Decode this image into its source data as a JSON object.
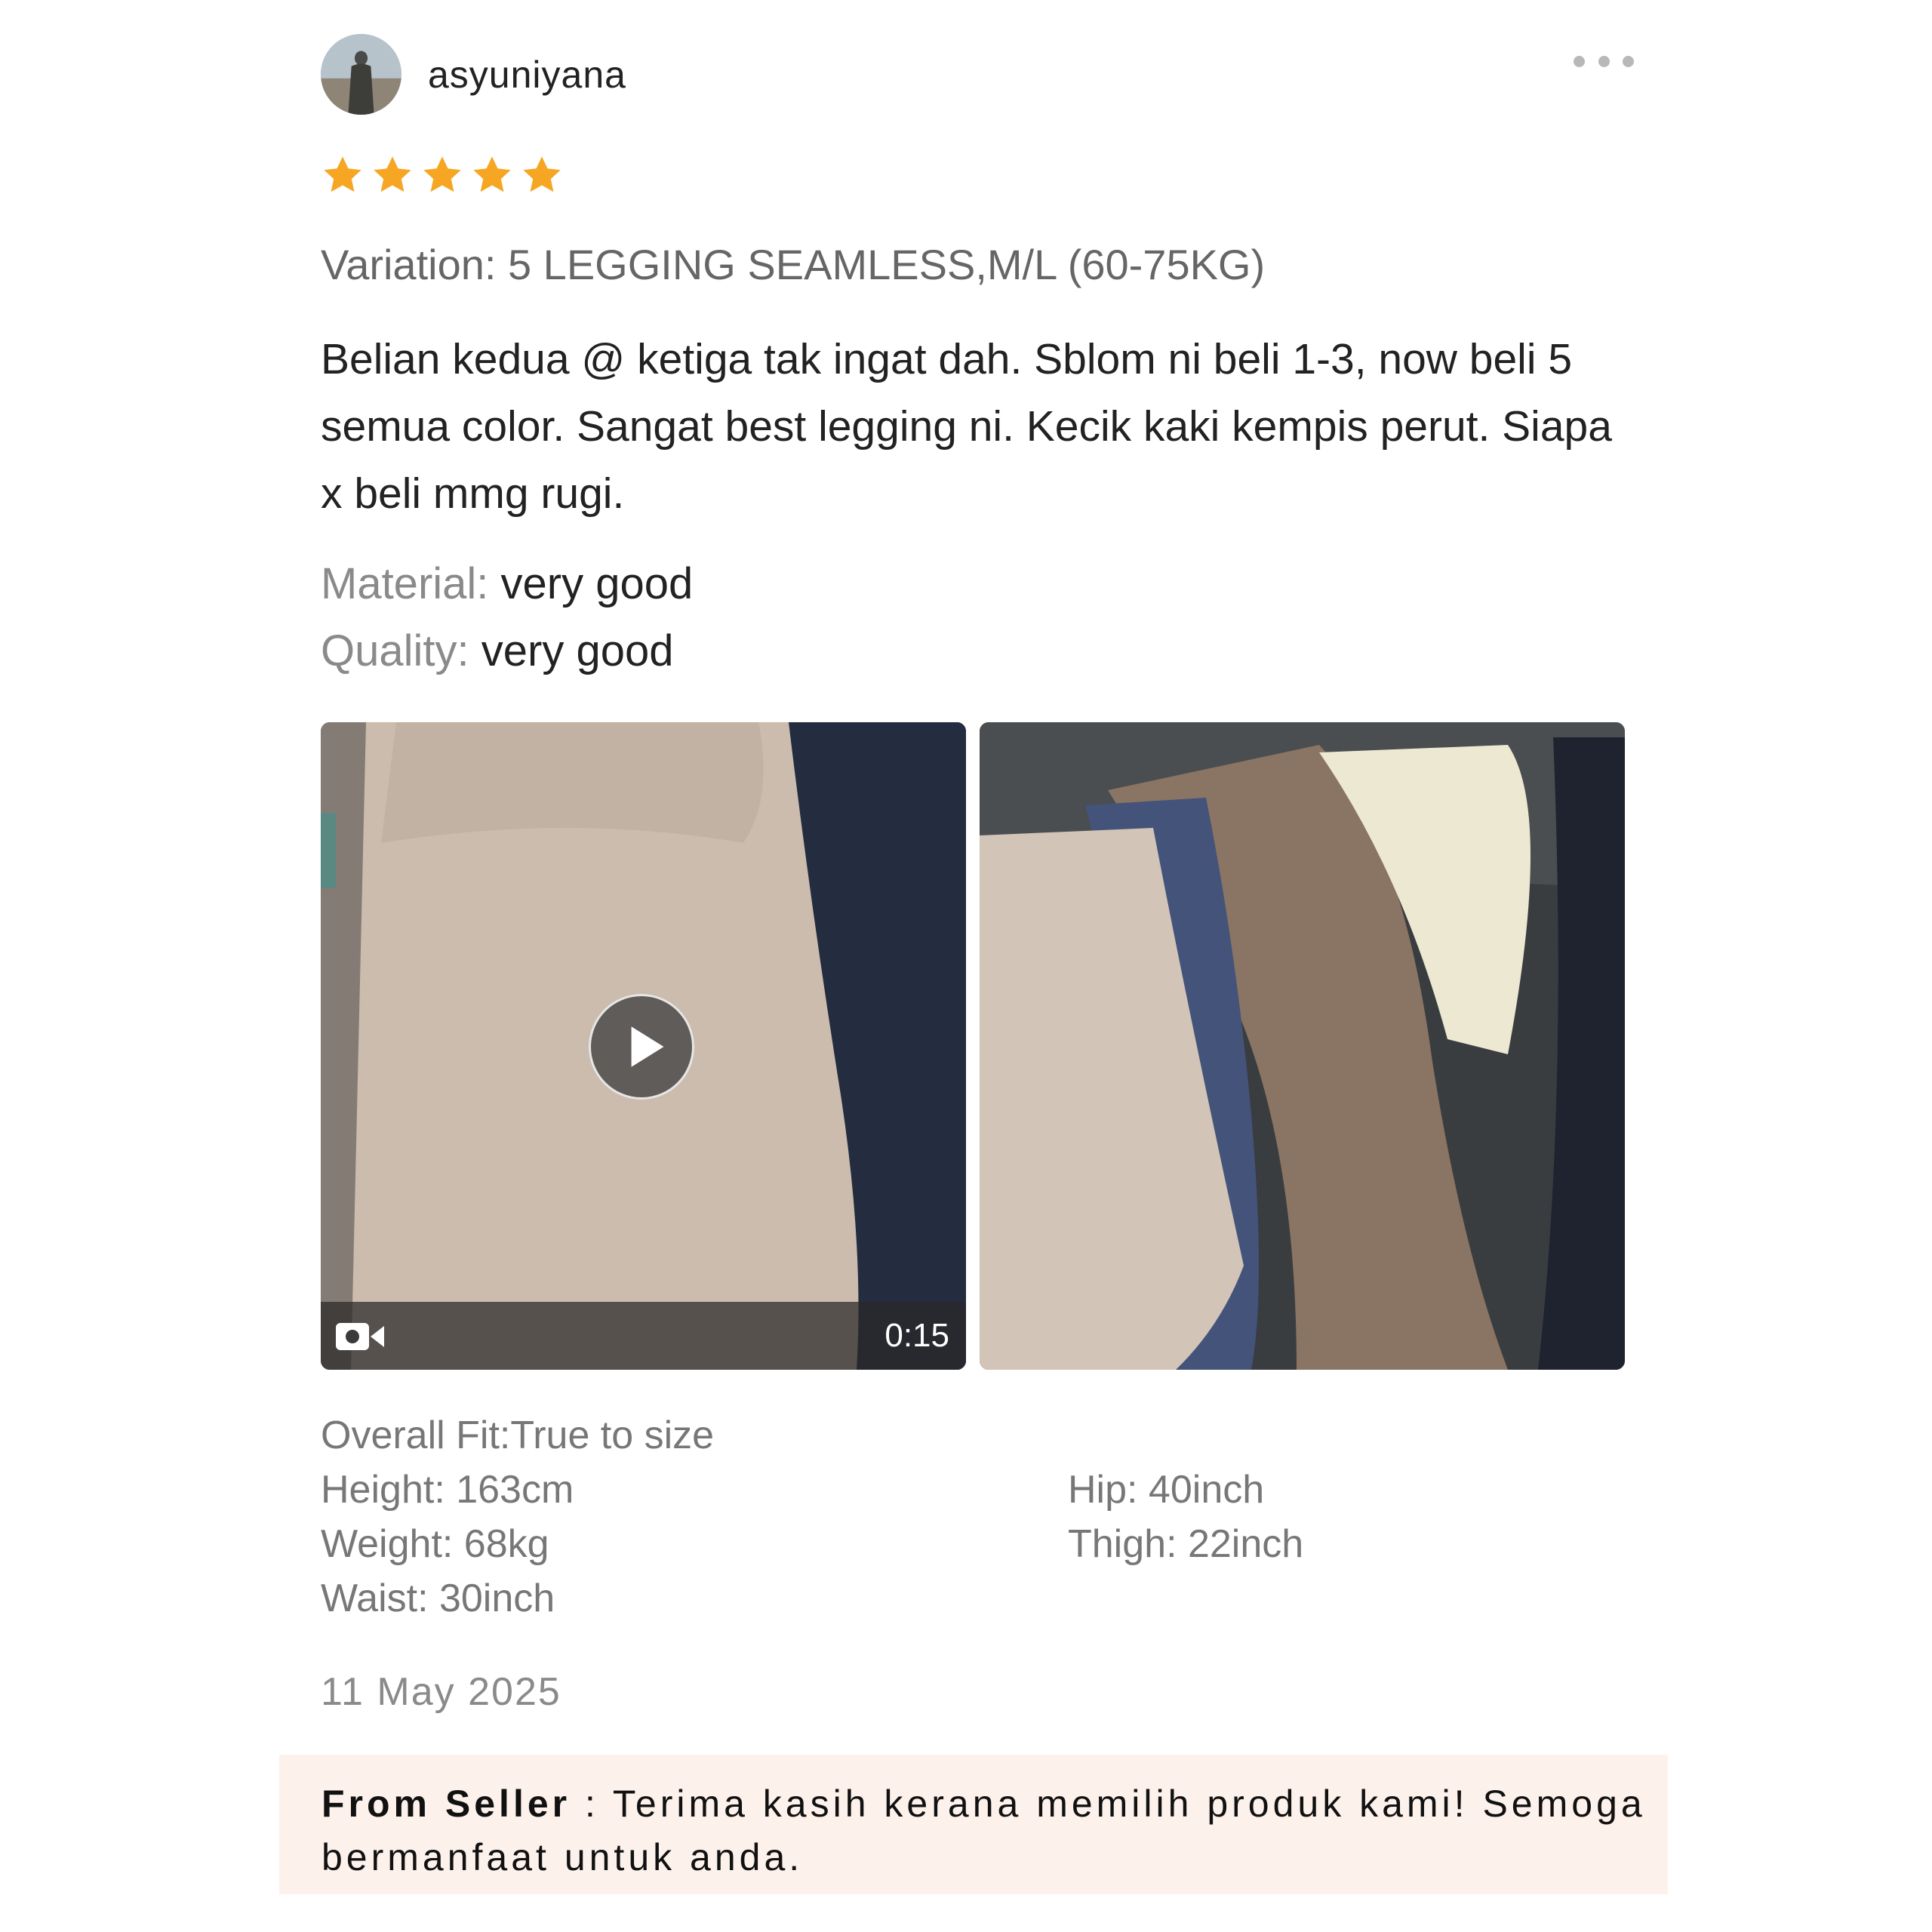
{
  "user": {
    "name": "asyuniyana",
    "rating": 5,
    "rating_max": 5
  },
  "menu": {
    "icon": "more-horizontal-icon"
  },
  "review": {
    "variation": "Variation: 5 LEGGING SEAMLESS,M/L (60-75KG)",
    "comment": "Belian kedua @ ketiga tak ingat dah. Sblom ni beli 1-3, now beli 5 semua color. Sangat best legging ni. Kecik kaki kempis perut. Siapa x beli mmg rugi.",
    "attributes": [
      {
        "key": "Material:",
        "value": "very good"
      },
      {
        "key": "Quality:",
        "value": "very good"
      }
    ]
  },
  "media": {
    "video": {
      "duration": "0:15",
      "icon": "video-camera-icon",
      "play_icon": "play-icon"
    }
  },
  "fit": {
    "overall": "Overall Fit:True to size",
    "left": [
      "Height: 163cm",
      "Weight: 68kg",
      "Waist: 30inch"
    ],
    "right": [
      "Hip: 40inch",
      "Thigh: 22inch"
    ]
  },
  "date": "11 May 2025",
  "seller": {
    "label": "From Seller",
    "separator": " : ",
    "message": "Terima kasih kerana memilih produk kami! Semoga bermanfaat untuk anda."
  },
  "colors": {
    "star": "#f6a623",
    "seller_bg": "#fdf1ec"
  }
}
